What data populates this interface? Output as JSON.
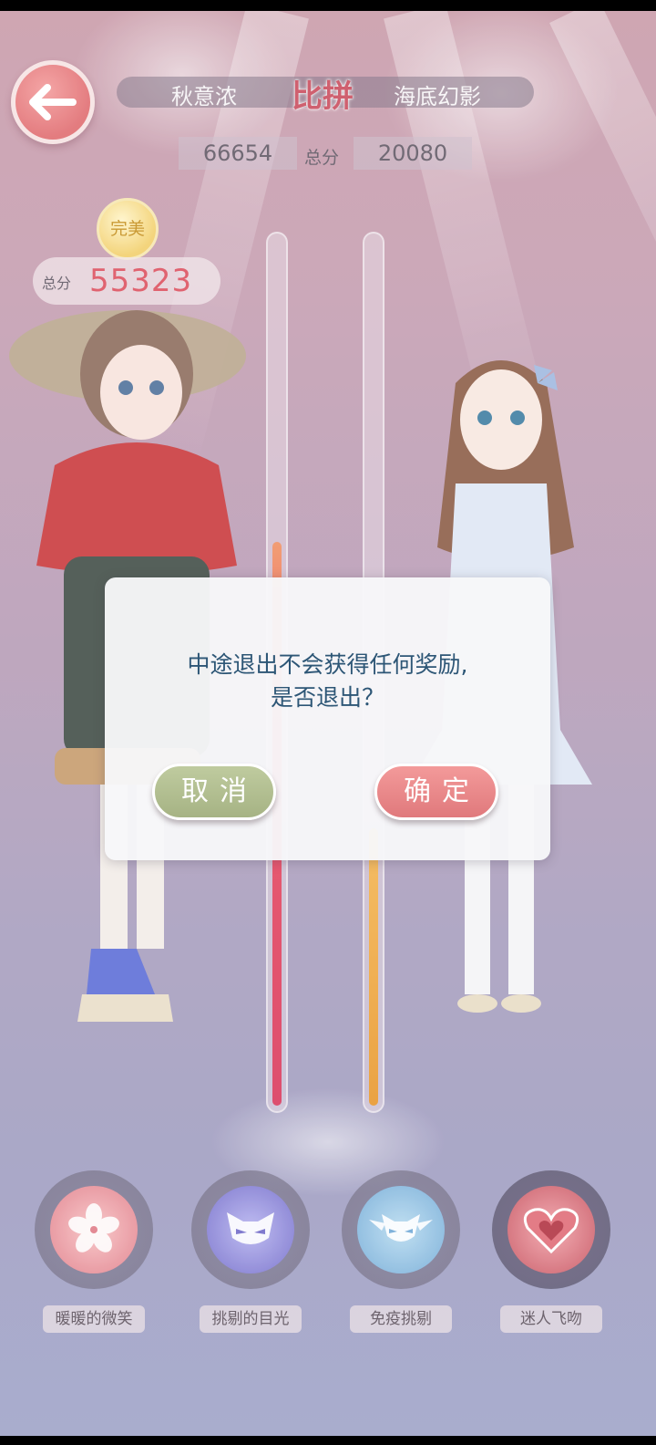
{
  "header": {
    "back_icon": "back-arrow-icon",
    "left_name": "秋意浓",
    "vs_title": "比拼",
    "right_name": "海底幻影",
    "left_score": "66654",
    "score_label": "总分",
    "right_score": "20080"
  },
  "player": {
    "medal_text": "完美",
    "total_label": "总分",
    "total_value": "55323"
  },
  "meters": {
    "left_fill": 0.65,
    "right_fill": 0.32
  },
  "skills": [
    {
      "label": "暖暖的微笑",
      "icon": "sakura-flower-icon"
    },
    {
      "label": "挑剔的目光",
      "icon": "mask-icon"
    },
    {
      "label": "免疫挑剔",
      "icon": "winged-mask-icon"
    },
    {
      "label": "迷人飞吻",
      "icon": "heart-icon"
    }
  ],
  "dialog": {
    "line1": "中途退出不会获得任何奖励,",
    "line2": "是否退出？",
    "cancel_label": "取消",
    "confirm_label": "确定"
  },
  "colors": {
    "accent_red": "#e06a6e",
    "accent_green": "#a6b384",
    "message_text": "#2d5676"
  }
}
